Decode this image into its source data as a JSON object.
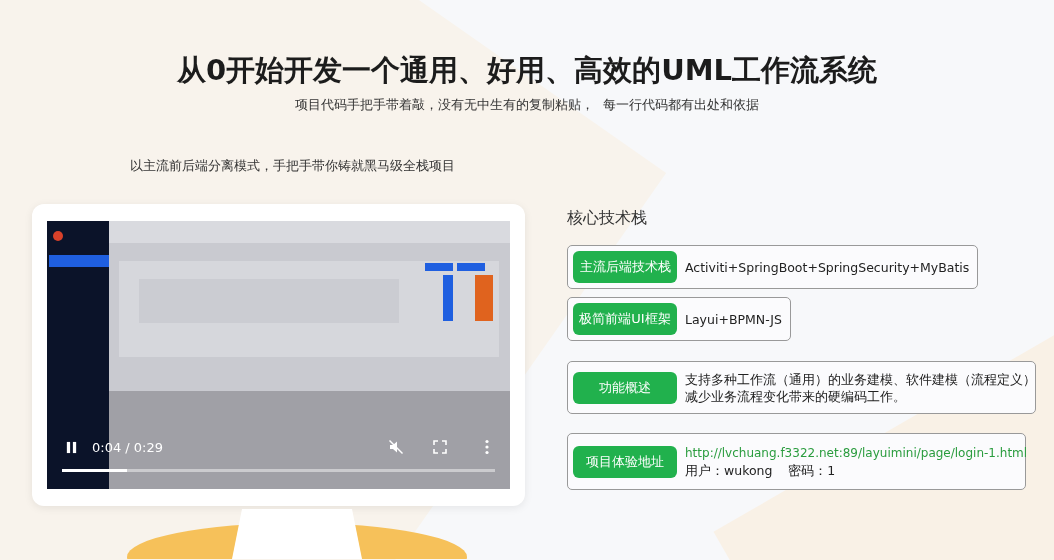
{
  "header": {
    "title": "从0开始开发一个通用、好用、高效的UML工作流系统",
    "subtitle": "项目代码手把手带着敲，没有无中生有的复制粘贴，  每一行代码都有出处和依据"
  },
  "intro": "以主流前后端分离模式，手把手带你铸就黑马级全栈项目",
  "video": {
    "kind": "picture",
    "playing": true,
    "time": "0:04 / 0:29",
    "muted": true,
    "level": 0.15
  },
  "tech": {
    "heading": "核心技术栈",
    "items": [
      {
        "label": "主流后端技术栈",
        "lines": [
          {
            "kind": "text",
            "text": "Activiti+SpringBoot+SpringSecurity+MyBatis"
          }
        ]
      },
      {
        "label": "极简前端UI框架",
        "lines": [
          {
            "kind": "text",
            "text": "Layui+BPMN-JS"
          }
        ]
      },
      {
        "label": "功能概述",
        "lines": [
          {
            "kind": "text",
            "text": "支持多种工作流（通用）的业务建模、软件建模（流程定义）"
          },
          {
            "kind": "text",
            "text": "减少业务流程变化带来的硬编码工作。"
          }
        ]
      },
      {
        "label": "项目体验地址",
        "lines": [
          {
            "kind": "link",
            "text": "http://lvchuang.f3322.net:89/layuimini/page/login-1.html"
          },
          {
            "kind": "text",
            "text": "用户：wukong    密码：1"
          }
        ]
      }
    ]
  }
}
